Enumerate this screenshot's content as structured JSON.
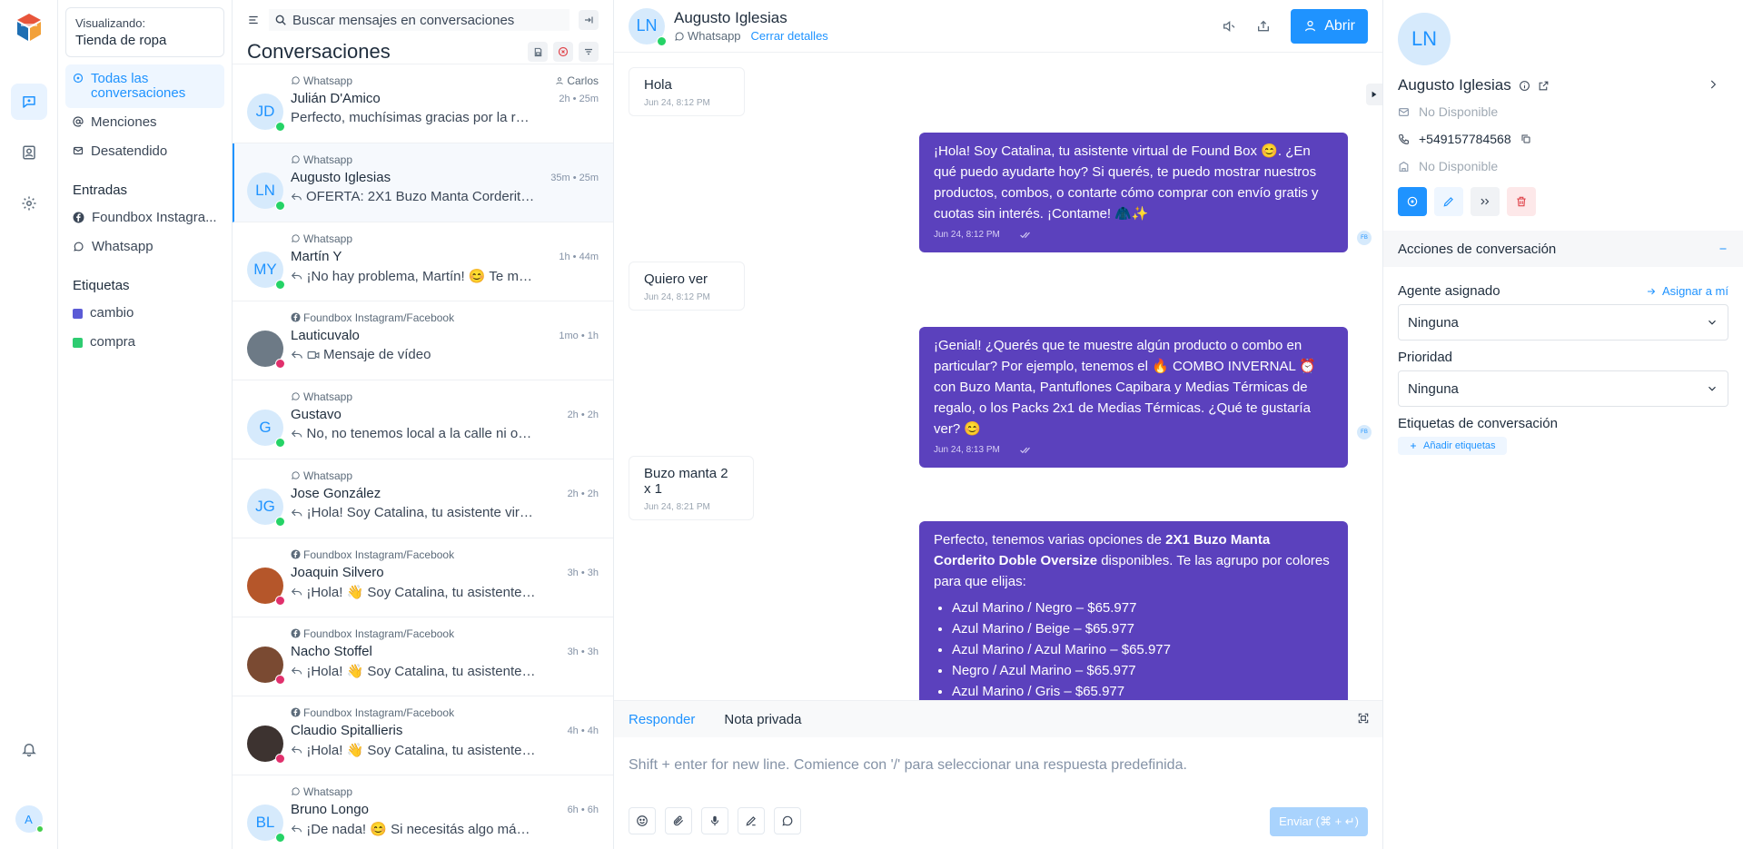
{
  "sidebar": {
    "account_label": "Visualizando:",
    "account_name": "Tienda de ropa",
    "all_conversations": "Todas las conversaciones",
    "mentions": "Menciones",
    "unattended": "Desatendido",
    "inboxes_heading": "Entradas",
    "inboxes": [
      {
        "label": "Foundbox Instagra..."
      },
      {
        "label": "Whatsapp"
      }
    ],
    "labels_heading": "Etiquetas",
    "labels": [
      {
        "label": "cambio",
        "color": "#5b5bd6"
      },
      {
        "label": "compra",
        "color": "#2ecc71"
      }
    ]
  },
  "rail": {
    "user_initial": "A"
  },
  "list": {
    "search_placeholder": "Buscar mensajes en conversaciones",
    "title": "Conversaciones",
    "conversations": [
      {
        "initials": "JD",
        "inbox": "Whatsapp",
        "assignee": "Carlos",
        "name": "Julián D'Amico",
        "time": "2h • 25m",
        "message": "Perfecto, muchísimas gracias por la res...",
        "reply_icon": false,
        "channel": "whatsapp",
        "photo": false
      },
      {
        "initials": "LN",
        "inbox": "Whatsapp",
        "assignee": "",
        "name": "Augusto Iglesias",
        "time": "35m • 25m",
        "message": "OFERTA: 2X1 Buzo Manta Corderito D...",
        "reply_icon": true,
        "channel": "whatsapp",
        "photo": false
      },
      {
        "initials": "MY",
        "inbox": "Whatsapp",
        "assignee": "",
        "name": "Martín Y",
        "time": "1h • 44m",
        "message": "¡No hay problema, Martín! 😊 Te mue...",
        "reply_icon": true,
        "channel": "whatsapp",
        "photo": false
      },
      {
        "initials": "",
        "inbox": "Foundbox Instagram/Facebook",
        "assignee": "",
        "name": "Lauticuvalo",
        "time": "1mo • 1h",
        "message": "Mensaje de vídeo",
        "reply_icon": true,
        "channel": "instagram",
        "photo": true,
        "photo_color": "#6d7a86"
      },
      {
        "initials": "G",
        "inbox": "Whatsapp",
        "assignee": "",
        "name": "Gustavo",
        "time": "2h • 2h",
        "message": "No, no tenemos local a la calle ni opc...",
        "reply_icon": true,
        "channel": "whatsapp",
        "photo": false
      },
      {
        "initials": "JG",
        "inbox": "Whatsapp",
        "assignee": "",
        "name": "Jose González",
        "time": "2h • 2h",
        "message": "¡Hola! Soy Catalina, tu asistente virtu...",
        "reply_icon": true,
        "channel": "whatsapp",
        "photo": false
      },
      {
        "initials": "",
        "inbox": "Foundbox Instagram/Facebook",
        "assignee": "",
        "name": "Joaquin Silvero",
        "time": "3h • 3h",
        "message": "¡Hola! 👋 Soy Catalina, tu asistente vi...",
        "reply_icon": true,
        "channel": "instagram",
        "photo": true,
        "photo_color": "#b5562a"
      },
      {
        "initials": "",
        "inbox": "Foundbox Instagram/Facebook",
        "assignee": "",
        "name": "Nacho Stoffel",
        "time": "3h • 3h",
        "message": "¡Hola! 👋 Soy Catalina, tu asistente vi...",
        "reply_icon": true,
        "channel": "instagram",
        "photo": true,
        "photo_color": "#7a4a32"
      },
      {
        "initials": "",
        "inbox": "Foundbox Instagram/Facebook",
        "assignee": "",
        "name": "Claudio Spitallieris",
        "time": "4h • 4h",
        "message": "¡Hola! 👋 Soy Catalina, tu asistente vi...",
        "reply_icon": true,
        "channel": "instagram",
        "photo": true,
        "photo_color": "#3d3330"
      },
      {
        "initials": "BL",
        "inbox": "Whatsapp",
        "assignee": "",
        "name": "Bruno Longo",
        "time": "6h • 6h",
        "message": "¡De nada! 😊 Si necesitás algo más, n...",
        "reply_icon": true,
        "channel": "whatsapp",
        "photo": false
      }
    ]
  },
  "chat": {
    "contact_initials": "LN",
    "contact_name": "Augusto Iglesias",
    "inbox": "Whatsapp",
    "close_details": "Cerrar detalles",
    "open_button": "Abrir",
    "bot_initials": "FB",
    "messages": {
      "m1": {
        "text": "Hola",
        "time": "Jun 24, 8:12 PM"
      },
      "m2": {
        "text": "¡Hola! Soy Catalina, tu asistente virtual de Found Box 😊. ¿En qué puedo ayudarte hoy? Si querés, te puedo mostrar nuestros productos, combos, o contarte cómo comprar con envío gratis y cuotas sin interés. ¡Contame! 🧥✨",
        "time": "Jun 24, 8:12 PM"
      },
      "m3": {
        "text": "Quiero ver",
        "time": "Jun 24, 8:12 PM"
      },
      "m4": {
        "text": "¡Genial! ¿Querés que te muestre algún producto o combo en particular? Por ejemplo, tenemos el 🔥 COMBO INVERNAL ⏰ con Buzo Manta, Pantuflones Capibara y Medias Térmicas de regalo, o los Packs 2x1 de Medias Térmicas. ¿Qué te gustaría ver? 😊",
        "time": "Jun 24, 8:13 PM"
      },
      "m5": {
        "text": "Buzo manta 2 x 1",
        "time": "Jun 24, 8:21 PM"
      },
      "m6": {
        "pre": "Perfecto, tenemos varias opciones de ",
        "bold": "2X1 Buzo Manta Corderito Doble Oversize",
        "post": " disponibles. Te las agrupo por colores para que elijas:",
        "items": [
          "Azul Marino / Negro – $65.977",
          "Azul Marino / Beige – $65.977",
          "Azul Marino / Azul Marino – $65.977",
          "Negro / Azul Marino – $65.977",
          "Azul Marino / Gris – $65.977"
        ]
      }
    },
    "reply_tab": "Responder",
    "private_note_tab": "Nota privada",
    "reply_placeholder": "Shift + enter for new line. Comience con '/' para seleccionar una respuesta predefinida.",
    "send_label": "Enviar (⌘ + ↵)"
  },
  "details": {
    "initials": "LN",
    "name": "Augusto Iglesias",
    "email": "No Disponible",
    "phone": "+549157784568",
    "company": "No Disponible",
    "actions_heading": "Acciones de conversación",
    "agent_label": "Agente asignado",
    "assign_me": "Asignar a mí",
    "agent_value": "Ninguna",
    "priority_label": "Prioridad",
    "priority_value": "Ninguna",
    "tags_label": "Etiquetas de conversación",
    "add_tags": "Añadir etiquetas"
  },
  "colors": {
    "accent": "#1f93ff",
    "bubble_out": "#5b41bd",
    "whatsapp": "#25d366",
    "instagram": "#e1306c",
    "danger": "#e0464d"
  }
}
